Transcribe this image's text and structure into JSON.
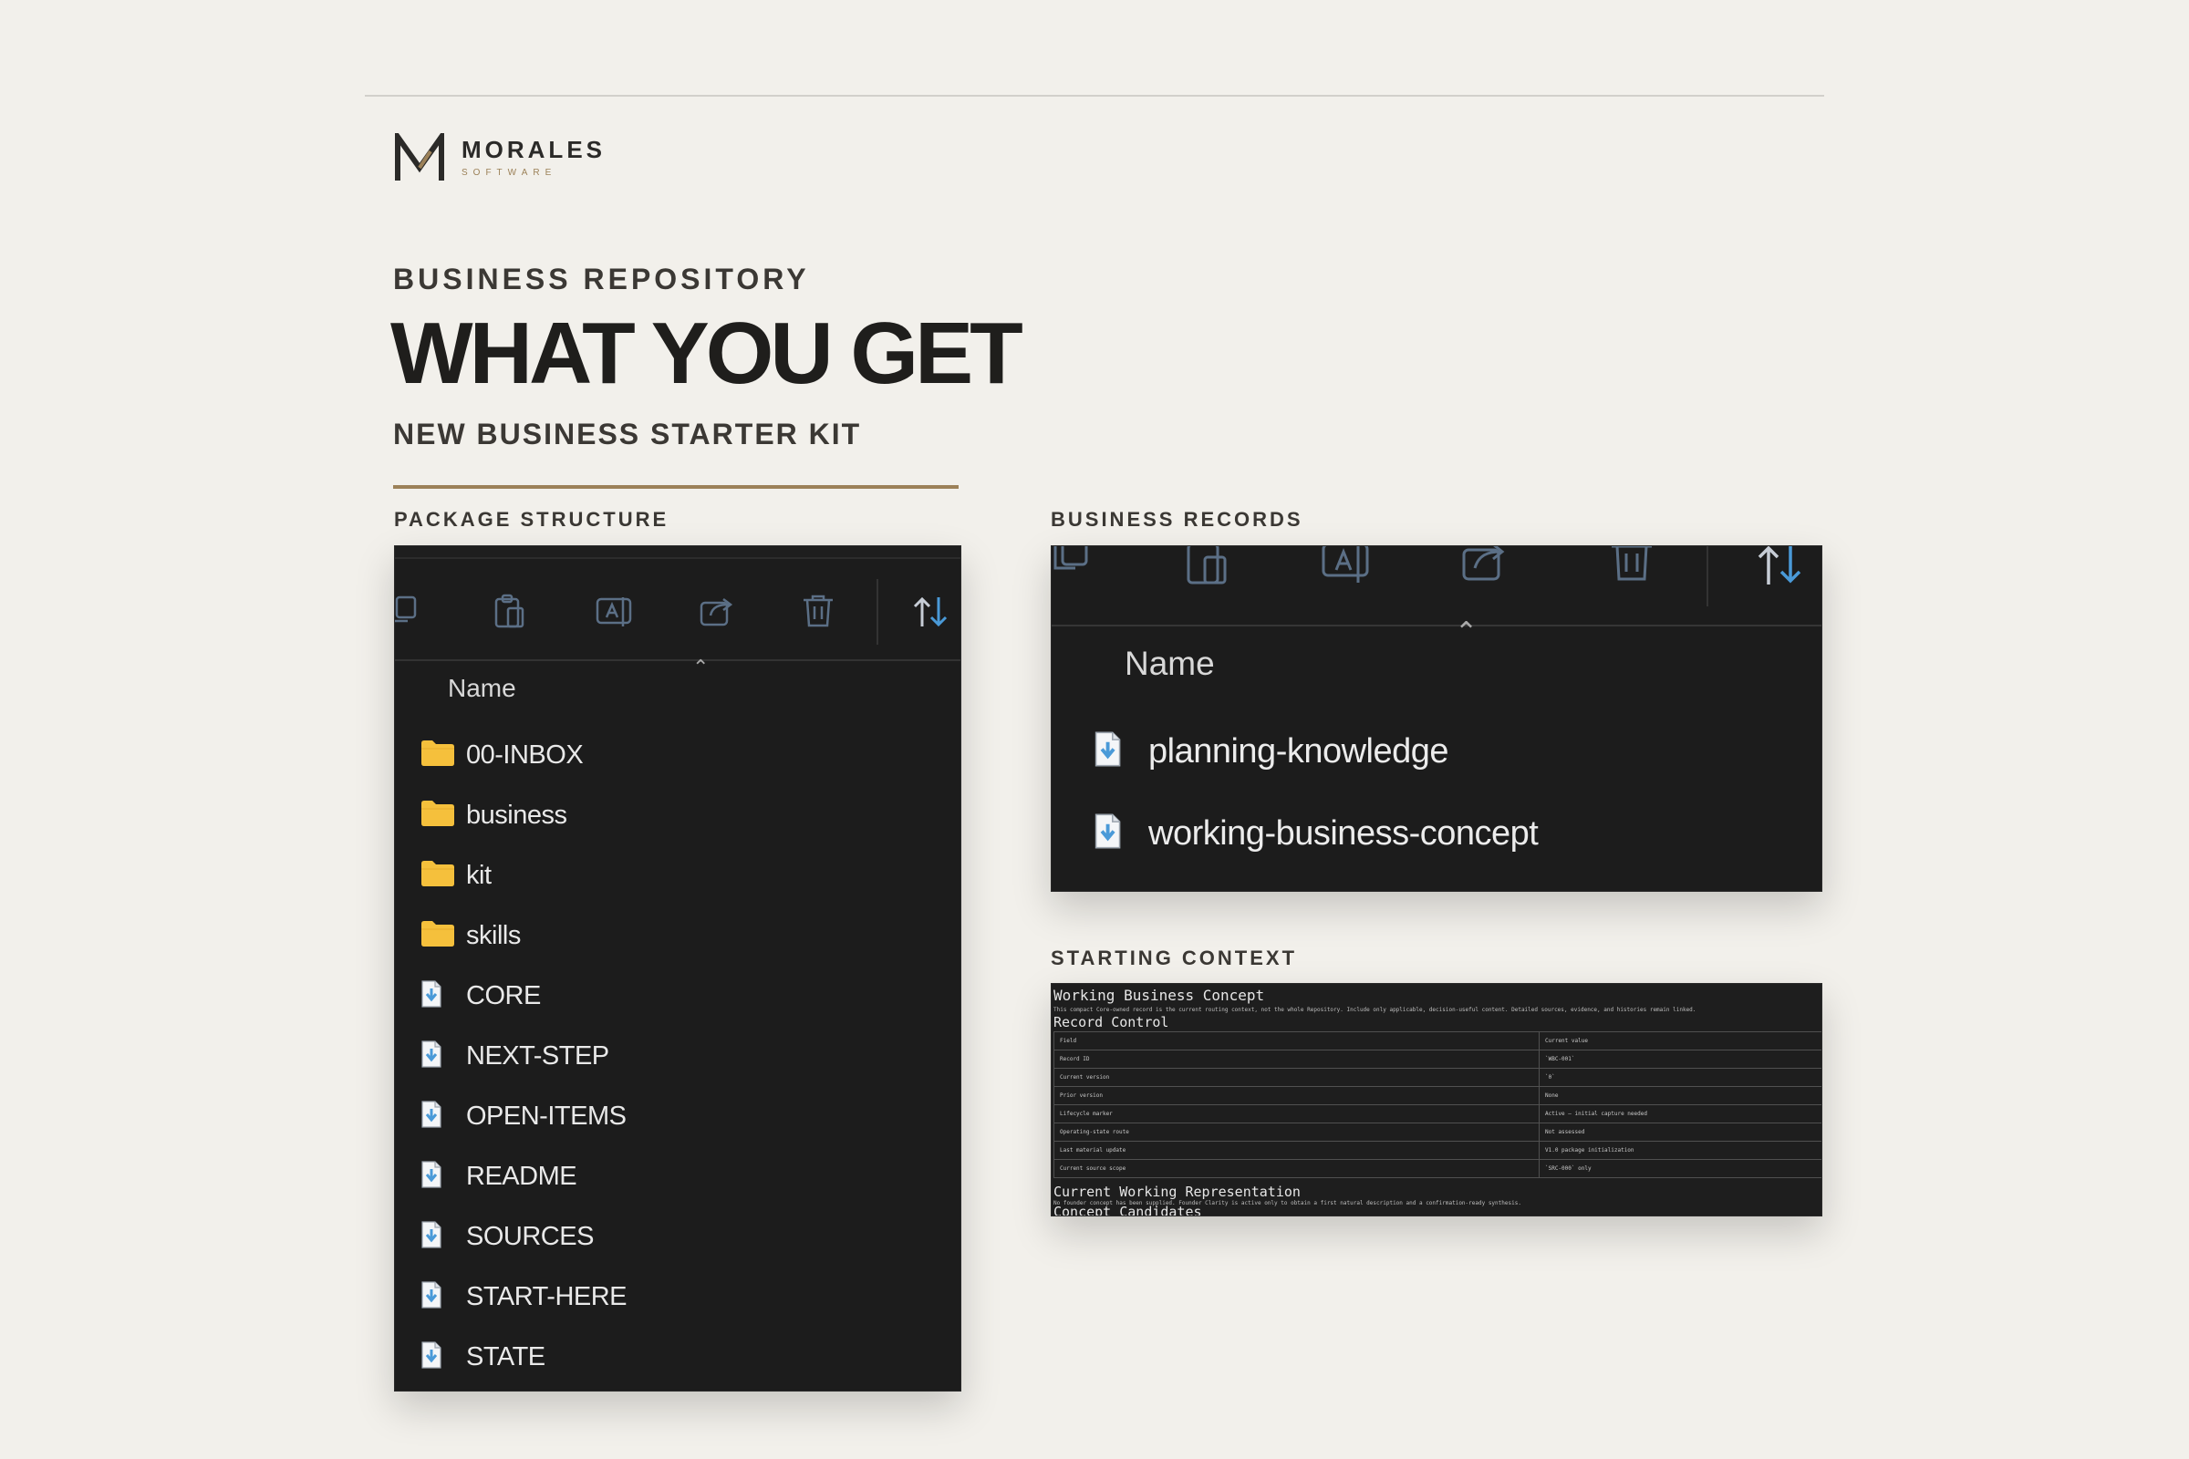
{
  "brand": {
    "name": "MORALES",
    "subtitle": "SOFTWARE"
  },
  "hero": {
    "eyebrow": "BUSINESS REPOSITORY",
    "title": "WHAT YOU GET",
    "subtitle": "NEW BUSINESS STARTER KIT"
  },
  "colors": {
    "background": "#f2f0eb",
    "accent": "#9c8158",
    "panel": "#1c1c1c",
    "folder": "#f5c03c",
    "icon_blue": "#4a9ad8"
  },
  "package_structure": {
    "label": "PACKAGE STRUCTURE",
    "toolbar_icons": [
      "copy-icon",
      "paste-icon",
      "rename-icon",
      "share-icon",
      "delete-icon",
      "sort-icon"
    ],
    "column_header": "Name",
    "items": [
      {
        "name": "00-INBOX",
        "type": "folder"
      },
      {
        "name": "business",
        "type": "folder"
      },
      {
        "name": "kit",
        "type": "folder"
      },
      {
        "name": "skills",
        "type": "folder"
      },
      {
        "name": "CORE",
        "type": "file"
      },
      {
        "name": "NEXT-STEP",
        "type": "file"
      },
      {
        "name": "OPEN-ITEMS",
        "type": "file"
      },
      {
        "name": "README",
        "type": "file"
      },
      {
        "name": "SOURCES",
        "type": "file"
      },
      {
        "name": "START-HERE",
        "type": "file"
      },
      {
        "name": "STATE",
        "type": "file"
      }
    ]
  },
  "business_records": {
    "label": "BUSINESS RECORDS",
    "toolbar_icons": [
      "copy-icon",
      "paste-icon",
      "rename-icon",
      "share-icon",
      "delete-icon",
      "sort-icon"
    ],
    "column_header": "Name",
    "items": [
      {
        "name": "planning-knowledge",
        "type": "file"
      },
      {
        "name": "working-business-concept",
        "type": "file"
      }
    ]
  },
  "starting_context": {
    "label": "STARTING CONTEXT",
    "title": "Working Business Concept",
    "intro": "This compact Core-owned record is the current routing context, not the whole Repository. Include only applicable, decision-useful content. Detailed sources, evidence, and histories remain linked.",
    "section_record_control": "Record Control",
    "table": {
      "header": [
        "Field",
        "Current value"
      ],
      "rows": [
        [
          "Record ID",
          "`WBC-001`"
        ],
        [
          "Current version",
          "`0`"
        ],
        [
          "Prior version",
          "None"
        ],
        [
          "Lifecycle marker",
          "Active — initial capture needed"
        ],
        [
          "Operating-state route",
          "Not assessed"
        ],
        [
          "Last material update",
          "V1.0 package initialization"
        ],
        [
          "Current source scope",
          "`SRC-000` only"
        ]
      ]
    },
    "section_representation": "Current Working Representation",
    "representation_note": "No founder concept has been supplied. Founder Clarity is active only to obtain a first natural description and a confirmation-ready synthesis.",
    "section_candidates": "Concept Candidates"
  }
}
